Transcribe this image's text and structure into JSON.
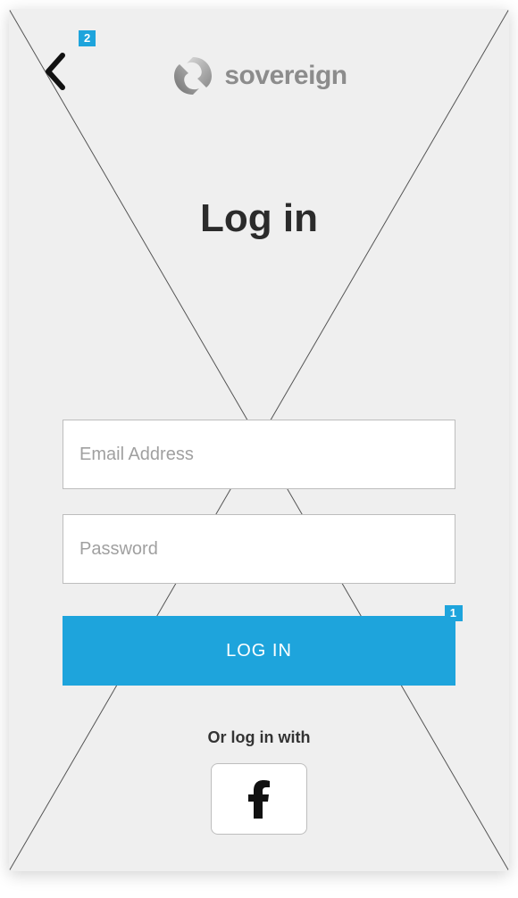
{
  "brand": {
    "name": "sovereign"
  },
  "page": {
    "title": "Log in"
  },
  "form": {
    "email_placeholder": "Email Address",
    "password_placeholder": "Password",
    "submit_label": "LOG IN"
  },
  "alt_login": {
    "label": "Or log in with"
  },
  "annotations": {
    "back": "2",
    "login": "1"
  },
  "colors": {
    "accent": "#1ea4dc"
  }
}
